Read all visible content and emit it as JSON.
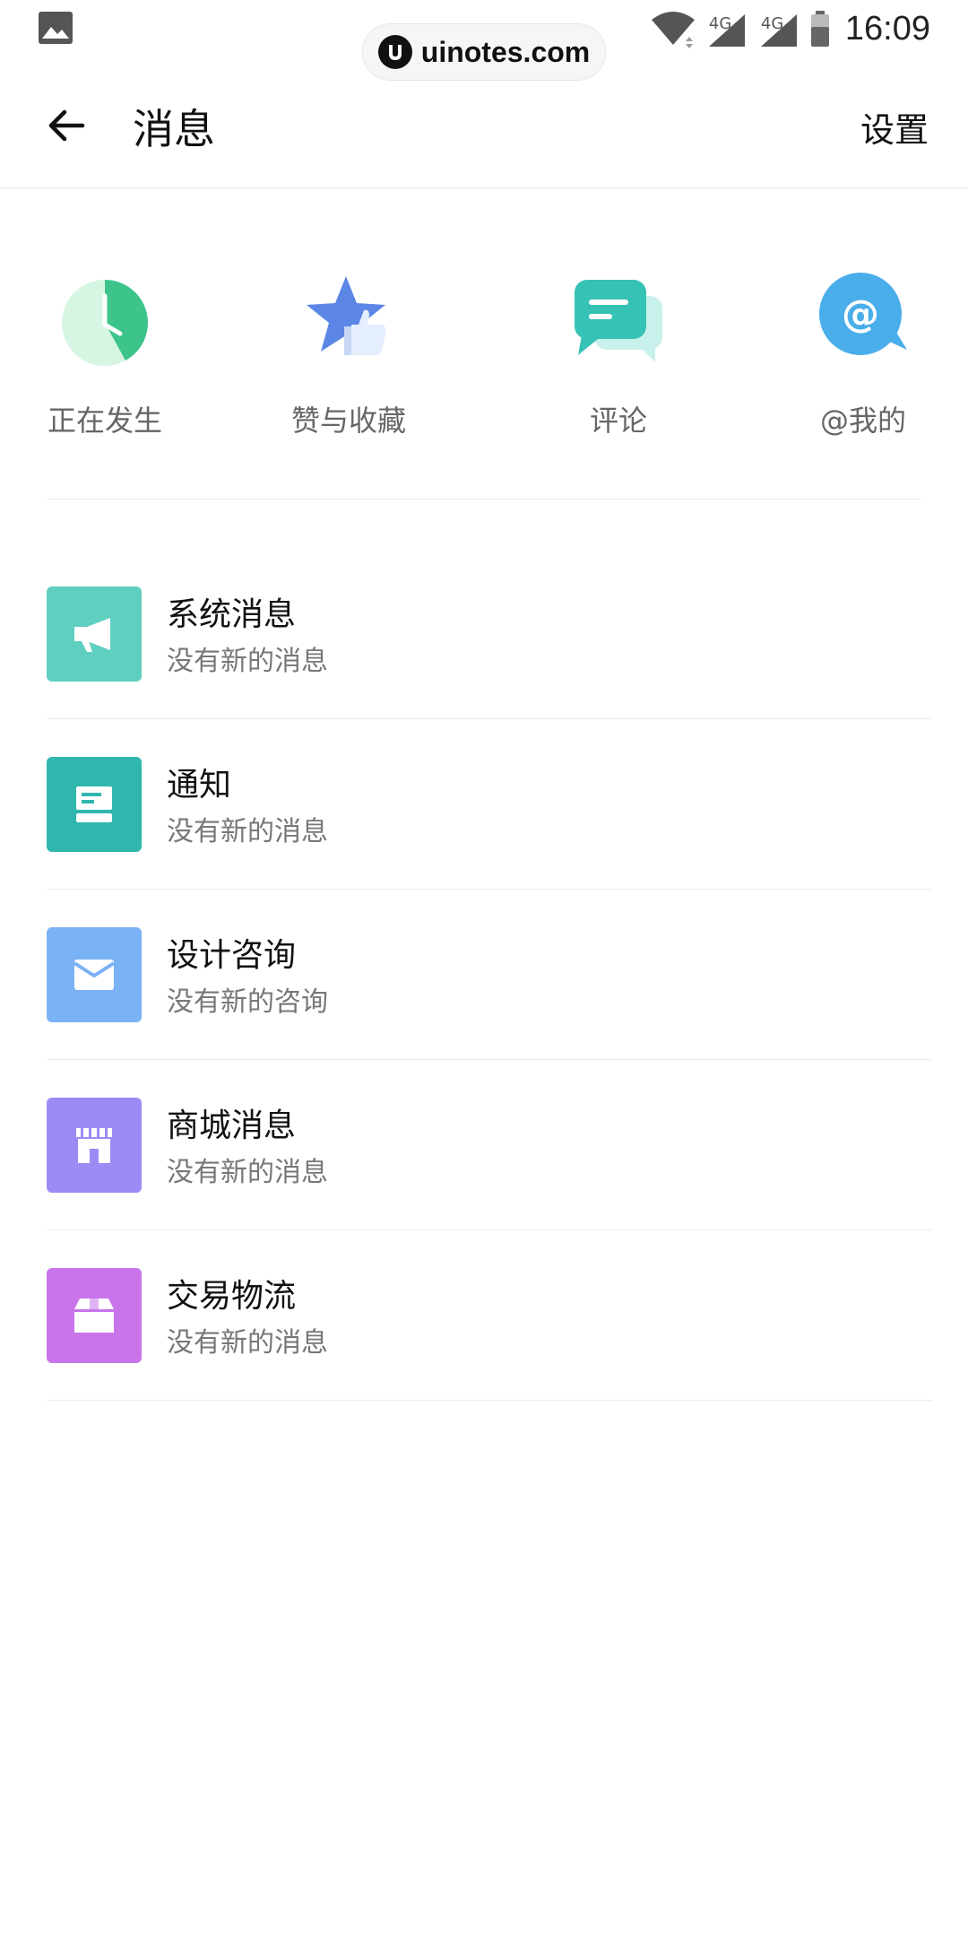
{
  "status_bar": {
    "time": "16:09",
    "network_labels": [
      "4G",
      "4G"
    ]
  },
  "watermark": {
    "text": "uinotes.com"
  },
  "header": {
    "title": "消息",
    "settings_label": "设置"
  },
  "quick_actions": [
    {
      "label": "正在发生",
      "icon": "clock-icon",
      "color": "#3cc48a"
    },
    {
      "label": "赞与收藏",
      "icon": "star-like-icon",
      "color": "#5b86e5"
    },
    {
      "label": "评论",
      "icon": "comment-icon",
      "color": "#36c2b4"
    },
    {
      "label": "@我的",
      "icon": "at-icon",
      "color": "#4aaeea"
    }
  ],
  "messages": [
    {
      "title": "系统消息",
      "subtitle": "没有新的消息",
      "icon": "megaphone-icon",
      "color": "#5fcfc0"
    },
    {
      "title": "通知",
      "subtitle": "没有新的消息",
      "icon": "notice-icon",
      "color": "#2fb7ae"
    },
    {
      "title": "设计咨询",
      "subtitle": "没有新的咨询",
      "icon": "envelope-icon",
      "color": "#7ab2f6"
    },
    {
      "title": "商城消息",
      "subtitle": "没有新的消息",
      "icon": "store-icon",
      "color": "#9b8cf5"
    },
    {
      "title": "交易物流",
      "subtitle": "没有新的消息",
      "icon": "box-icon",
      "color": "#c874ea"
    }
  ]
}
